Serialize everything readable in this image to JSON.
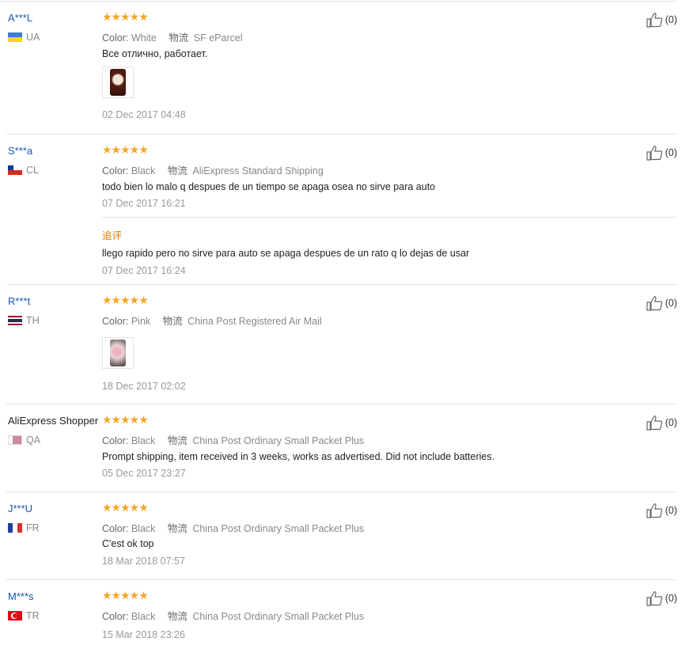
{
  "reviews": [
    {
      "user": "A***L",
      "country": "UA",
      "stars": "★★★★★",
      "color_label": "Color:",
      "color": "White",
      "ship_cn": "物流",
      "ship": "SF eParcel",
      "text": "Все отлично, работает.",
      "date": "02 Dec 2017 04:48",
      "likes": "(0)"
    },
    {
      "user": "S***a",
      "country": "CL",
      "stars": "★★★★★",
      "color_label": "Color:",
      "color": "Black",
      "ship_cn": "物流",
      "ship": "AliExpress Standard Shipping",
      "text": "todo bien lo malo q despues de un tiempo se apaga osea no sirve para auto",
      "date": "07 Dec 2017 16:21",
      "additional_title": "追评",
      "additional_text": "llego rapido pero no sirve para auto se apaga despues de un rato q lo dejas de usar",
      "additional_date": "07 Dec 2017 16:24",
      "likes": "(0)"
    },
    {
      "user": "R***t",
      "country": "TH",
      "stars": "★★★★★",
      "color_label": "Color:",
      "color": "Pink",
      "ship_cn": "物流",
      "ship": "China Post Registered Air Mail",
      "date": "18 Dec 2017 02:02",
      "likes": "(0)"
    },
    {
      "user": "AliExpress Shopper",
      "country": "QA",
      "stars": "★★★★★",
      "color_label": "Color:",
      "color": "Black",
      "ship_cn": "物流",
      "ship": "China Post Ordinary Small Packet Plus",
      "text": "Prompt shipping, item received in 3 weeks, works as advertised. Did not include batteries.",
      "date": "05 Dec 2017 23:27",
      "likes": "(0)"
    },
    {
      "user": "J***U",
      "country": "FR",
      "stars": "★★★★★",
      "color_label": "Color:",
      "color": "Black",
      "ship_cn": "物流",
      "ship": "China Post Ordinary Small Packet Plus",
      "text": "C'est ok top",
      "date": "18 Mar 2018 07:57",
      "likes": "(0)"
    },
    {
      "user": "M***s",
      "country": "TR",
      "stars": "★★★★★",
      "color_label": "Color:",
      "color": "Black",
      "ship_cn": "物流",
      "ship": "China Post Ordinary Small Packet Plus",
      "date": "15 Mar 2018 23:26",
      "likes": "(0)"
    }
  ],
  "icons": {
    "like": "thumbs-up-icon",
    "star": "star-icon"
  },
  "colors": {
    "user_link": "#1a56b0",
    "stars": "#f5a623",
    "additional_title": "#e07b00"
  }
}
